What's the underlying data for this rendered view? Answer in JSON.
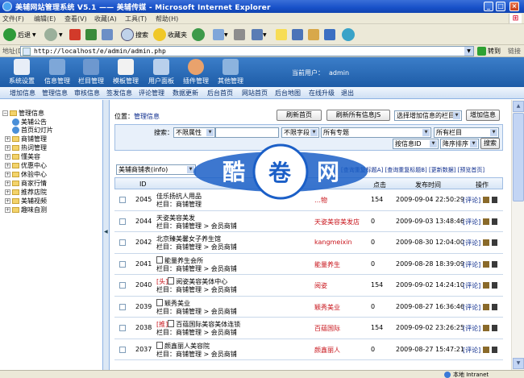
{
  "window": {
    "title": "美辅网站管理系统 V5.1 —— 美辅传媒 - Microsoft Internet Explorer"
  },
  "ie_menu": [
    "文件(F)",
    "编辑(E)",
    "查看(V)",
    "收藏(A)",
    "工具(T)",
    "帮助(H)"
  ],
  "ie_toolbar": {
    "back": "后退",
    "search": "搜索",
    "favorites": "收藏夹"
  },
  "address": {
    "label": "地址(D)",
    "url": "http://localhost/e/admin/admin.php",
    "go": "转到",
    "links": "链接"
  },
  "app_nav": [
    {
      "label": "系统设置",
      "color": "#e8eef7"
    },
    {
      "label": "信息管理",
      "color": "#7ea7d8"
    },
    {
      "label": "栏目管理",
      "color": "#6e98cf"
    },
    {
      "label": "模板管理",
      "color": "#f2f2f2"
    },
    {
      "label": "用户面板",
      "color": "#b9d0ec"
    },
    {
      "label": "插件管理",
      "color": "#e9a26c"
    },
    {
      "label": "其他管理",
      "color": "#8cb3de"
    }
  ],
  "user": {
    "label": "当前用户：",
    "name": "admin"
  },
  "subnav": [
    "增加信息",
    "管理信息",
    "审核信息",
    "签发信息",
    "评论管理",
    "数据更新",
    "后台首页",
    "网站首页",
    "后台地图",
    "在线升级",
    "退出"
  ],
  "tree": {
    "root": "管理信息",
    "items": [
      {
        "label": "美辅公告",
        "type": "globe"
      },
      {
        "label": "首页幻灯片",
        "type": "globe"
      },
      {
        "label": "商铺管理",
        "type": "folder"
      },
      {
        "label": "热词管理",
        "type": "folder"
      },
      {
        "label": "懂美容",
        "type": "folder"
      },
      {
        "label": "优惠中心",
        "type": "folder"
      },
      {
        "label": "休验中心",
        "type": "folder"
      },
      {
        "label": "商家行情",
        "type": "folder"
      },
      {
        "label": "推荐店院",
        "type": "folder"
      },
      {
        "label": "美辅视频",
        "type": "folder"
      },
      {
        "label": "趣味自测",
        "type": "folder"
      }
    ]
  },
  "main": {
    "location_label": "位置：",
    "location": "管理信息",
    "btn_refresh_home": "刷新首页",
    "btn_refresh_js": "刷新所有信息JS",
    "select_column": "选择增加信息的栏目",
    "btn_add": "增加信息",
    "search": {
      "label": "搜索：",
      "attr": "不限属性",
      "field": "不限字段",
      "topic": "所有专题",
      "column": "所有栏目",
      "order_by": "按信息ID",
      "order": "降序排序",
      "btn": "搜索"
    },
    "table_select": "美辅商铺表(info)",
    "table_links": "[查询重复标题A] [查询重复标题B] [更新数据] [预览首页]",
    "headers": {
      "id": "ID",
      "clicks": "点击",
      "time": "发布时间",
      "ops": "操作"
    },
    "op_comment": "[评论]",
    "column_prefix": "栏目：",
    "rows": [
      {
        "id": "2045",
        "flag": "",
        "title": "佳乐扬抗人用品",
        "column": "商铺管理",
        "shop": "…物",
        "clicks": "154",
        "time": "2009-09-04 22:50:29"
      },
      {
        "id": "2044",
        "flag": "",
        "title": "天姿美容美发",
        "column": "商铺管理 > 会员商铺",
        "shop": "天姿美容美发店",
        "clicks": "0",
        "time": "2009-09-03 13:48:46"
      },
      {
        "id": "2042",
        "flag": "",
        "title": "北京臻美馨女子养生馆",
        "column": "商铺管理 > 会员商铺",
        "shop": "kangmeixin",
        "clicks": "0",
        "time": "2009-08-30 12:04:00"
      },
      {
        "id": "2041",
        "flag": "",
        "title": "能量养生会所",
        "column": "商铺管理 > 会员商铺",
        "shop": "能量养生",
        "clicks": "0",
        "time": "2009-08-28 18:39:09"
      },
      {
        "id": "2040",
        "flag": "[头]",
        "title": "阅姿美容美体中心",
        "column": "商铺管理 > 会员商铺",
        "shop": "阅姿",
        "clicks": "154",
        "time": "2009-09-02 14:24:10"
      },
      {
        "id": "2039",
        "flag": "",
        "title": "颖秀美业",
        "column": "商铺管理 > 会员商铺",
        "shop": "颖秀美业",
        "clicks": "0",
        "time": "2009-08-27 16:36:46"
      },
      {
        "id": "2038",
        "flag": "[推]",
        "title": "百蕴国际美容美体连锁",
        "column": "商铺管理 > 会员商铺",
        "shop": "百蕴国际",
        "clicks": "154",
        "time": "2009-09-02 23:26:25"
      },
      {
        "id": "2037",
        "flag": "",
        "title": "颜鑫丽人美容院",
        "column": "商铺管理 > 会员商铺",
        "shop": "颜鑫丽人",
        "clicks": "0",
        "time": "2009-08-27 15:47:21"
      }
    ]
  },
  "watermark": [
    "酷",
    "卷",
    "网"
  ],
  "status": {
    "zone": "本地 Intranet"
  },
  "colors": {
    "header": "#2a6bb8",
    "accent_red": "#c8141b",
    "link_blue": "#0a2a8c"
  }
}
